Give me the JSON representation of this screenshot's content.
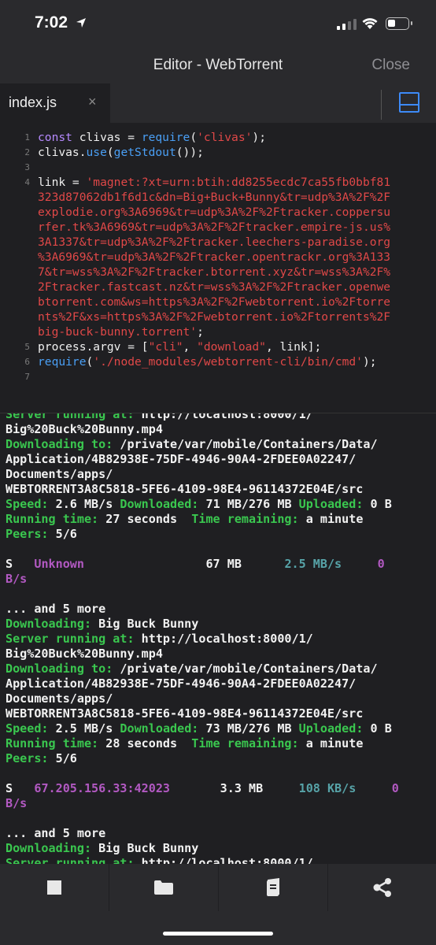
{
  "status_bar": {
    "time": "7:02"
  },
  "nav": {
    "title": "Editor - WebTorrent",
    "close_label": "Close"
  },
  "tab": {
    "name": "index.js",
    "close": "×"
  },
  "editor": {
    "line_numbers": [
      "1",
      "2",
      "3",
      "4",
      "5",
      "6",
      "7"
    ],
    "l1": {
      "kw": "const",
      "a": " clivas = ",
      "fn": "require",
      "b": "(",
      "str": "'clivas'",
      "c": ");"
    },
    "l2": {
      "a": "clivas.",
      "fn1": "use",
      "b": "(",
      "fn2": "getStdout",
      "c": "());"
    },
    "l4": {
      "a": "link = ",
      "str": [
        "'magnet:?xt=urn:btih:dd8255ecdc7ca55fb0bbf81",
        "323d87062db1f6d1c&dn=Big+Buck+Bunny&tr=udp%3A%2F%2F",
        "explodie.org%3A6969&tr=udp%3A%2F%2Ftracker.coppersu",
        "rfer.tk%3A6969&tr=udp%3A%2F%2Ftracker.empire-js.us%",
        "3A1337&tr=udp%3A%2F%2Ftracker.leechers-paradise.org",
        "%3A6969&tr=udp%3A%2F%2Ftracker.opentrackr.org%3A133",
        "7&tr=wss%3A%2F%2Ftracker.btorrent.xyz&tr=wss%3A%2F%",
        "2Ftracker.fastcast.nz&tr=wss%3A%2F%2Ftracker.openwe",
        "btorrent.com&ws=https%3A%2F%2Fwebtorrent.io%2Ftorre",
        "nts%2F&xs=https%3A%2F%2Fwebtorrent.io%2Ftorrents%2F",
        "big-buck-bunny.torrent'"
      ],
      "end": ";"
    },
    "l5": {
      "a": "process.argv = [",
      "s1": "\"cli\"",
      "b": ", ",
      "s2": "\"download\"",
      "c": ", link];"
    },
    "l6": {
      "fn": "require",
      "a": "(",
      "str": "'./node_modules/webtorrent-cli/bin/cmd'",
      "b": ");"
    }
  },
  "terminal": {
    "server_label": "Server running at:",
    "server_url": "http://localhost:8000/1/",
    "file_path": "Big%20Buck%20Bunny.mp4",
    "downloading_to_label": "Downloading to:",
    "path_1": "/private/var/mobile/Containers/Data/",
    "path_2": "Application/4B82938E-75DF-4946-90A4-2FDEE0A02247/",
    "path_3": "Documents/apps/",
    "path_4": "WEBTORRENT3A8C5818-5FE6-4109-98E4-96114372E04E/src",
    "speed_label": "Speed:",
    "downloaded_label": "Downloaded:",
    "uploaded_label": "Uploaded:",
    "running_time_label": "Running time:",
    "time_remaining_label": "Time remaining:",
    "peers_label": "Peers:",
    "downloading_label": "Downloading:",
    "torrent_name": "Big Buck Bunny",
    "more": "... and 5 more",
    "blocks": [
      {
        "speed": "2.6 MB/s",
        "downloaded": "71 MB/276 MB",
        "uploaded": "0 B",
        "running": "27 seconds",
        "remaining": "a minute",
        "peers": "5/6",
        "peer": {
          "flag": "S",
          "address": "Unknown",
          "size": "67 MB",
          "rate": "2.5 MB/s",
          "up": "0",
          "unit": "B/s"
        }
      },
      {
        "speed": "2.5 MB/s",
        "downloaded": "73 MB/276 MB",
        "uploaded": "0 B",
        "running": "28 seconds",
        "remaining": "a minute",
        "peers": "5/6",
        "peer": {
          "flag": "S",
          "address": "67.205.156.33:42023",
          "size": "3.3 MB",
          "rate": "108 KB/s",
          "up": "0",
          "unit": "B/s"
        }
      }
    ]
  },
  "toolbar": {
    "items": [
      "stop-icon",
      "folder-icon",
      "book-icon",
      "share-icon"
    ]
  },
  "colors": {
    "accent": "#3d8af7",
    "string": "#e04848",
    "keyword": "#b68aff",
    "function": "#4a9ff5",
    "term_label": "#3ac74f",
    "term_peer": "#b259c2",
    "term_rate": "#57a3a8"
  }
}
